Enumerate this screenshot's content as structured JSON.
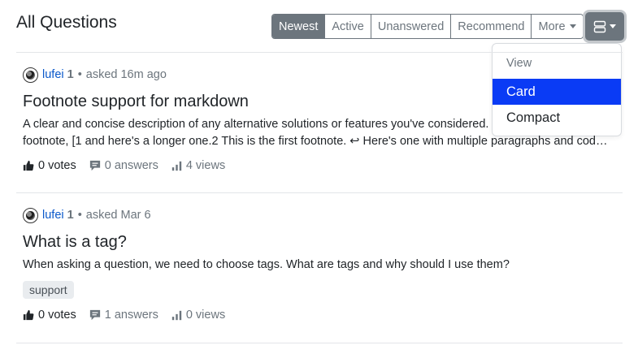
{
  "header": {
    "title": "All Questions"
  },
  "sort_tabs": [
    {
      "label": "Newest"
    },
    {
      "label": "Active"
    },
    {
      "label": "Unanswered"
    },
    {
      "label": "Recommend"
    },
    {
      "label": "More"
    }
  ],
  "view_menu": {
    "header": "View",
    "items": [
      {
        "label": "Card"
      },
      {
        "label": "Compact"
      }
    ]
  },
  "questions": [
    {
      "author": "lufei",
      "reputation": "1",
      "separator": "•",
      "asked": "asked 16m ago",
      "title": "Footnote support for markdown",
      "excerpt_line1": "A clear and concise description of any alternative solutions or features you've considered.",
      "excerpt_line2": "footnote, [1 and here's a longer one.2 This is the first footnote. ↩ Here's one with multiple paragraphs and cod…",
      "votes": "0 votes",
      "answers": "0 answers",
      "views": "4 views"
    },
    {
      "author": "lufei",
      "reputation": "1",
      "separator": "•",
      "asked": "asked Mar 6",
      "title": "What is a tag?",
      "excerpt_line1": "When asking a question, we need to choose tags. What are tags and why should I use them?",
      "tag": "support",
      "votes": "0 votes",
      "answers": "1 answers",
      "views": "0 views"
    }
  ],
  "colors": {
    "active_tab": "#6c757d",
    "selected_item": "#0a3bf5",
    "author_link": "#0a58ca"
  }
}
